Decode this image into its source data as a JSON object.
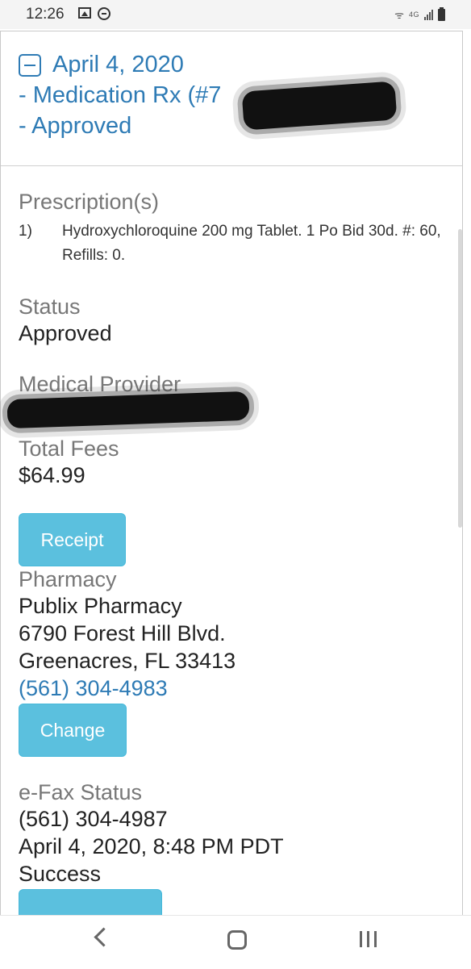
{
  "status_bar": {
    "time": "12:26",
    "network": "4G"
  },
  "record": {
    "date": "April 4, 2020",
    "title_line2": "- Medication Rx (#7",
    "title_line3": "- Approved"
  },
  "prescriptions": {
    "label": "Prescription(s)",
    "items": [
      {
        "num": "1)",
        "text": "Hydroxychloroquine 200 mg Tablet. 1 Po Bid 30d. #: 60, Refills: 0."
      }
    ]
  },
  "status": {
    "label": "Status",
    "value": "Approved"
  },
  "provider": {
    "label": "Medical Provider"
  },
  "fees": {
    "label": "Total Fees",
    "value": "$64.99"
  },
  "receipt_button": "Receipt",
  "pharmacy": {
    "label": "Pharmacy",
    "name": "Publix Pharmacy",
    "address1": "6790 Forest Hill Blvd.",
    "address2": "Greenacres, FL 33413",
    "phone": "(561) 304-4983"
  },
  "change_button": "Change",
  "efax": {
    "label": "e-Fax Status",
    "number": "(561) 304-4987",
    "datetime": "April 4, 2020, 8:48 PM PDT",
    "result": "Success"
  },
  "colors": {
    "link": "#2e7bb5",
    "button": "#5bc0de"
  }
}
